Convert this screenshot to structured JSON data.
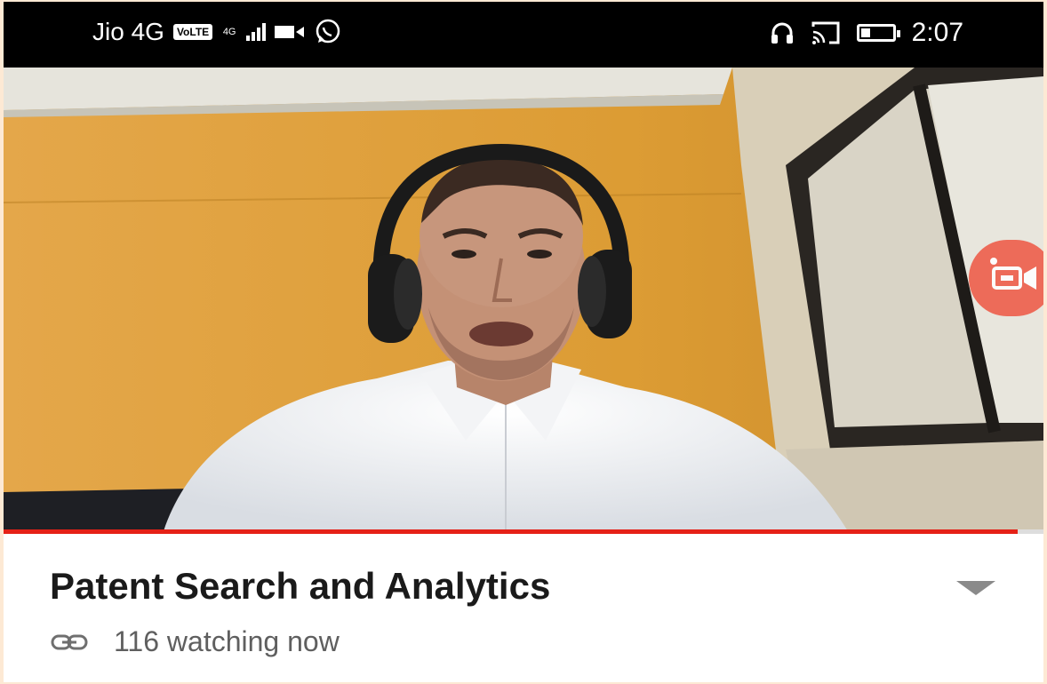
{
  "status_bar": {
    "carrier": "Jio 4G",
    "volte_badge": "VoLTE",
    "network_type": "4G",
    "time": "2:07",
    "battery_level": 0.25
  },
  "icons": [
    "signal-icon",
    "video-call-icon",
    "whatsapp-icon",
    "headphones-icon",
    "cast-icon",
    "battery-icon",
    "record-icon",
    "link-icon",
    "collapse-icon"
  ],
  "video": {
    "progress": 0.975
  },
  "info": {
    "title": "Patent Search and Analytics",
    "watching": "116 watching now"
  },
  "colors": {
    "progress": "#e52117",
    "wall": "#e0a13c",
    "record_button": "#ee5e4b"
  }
}
